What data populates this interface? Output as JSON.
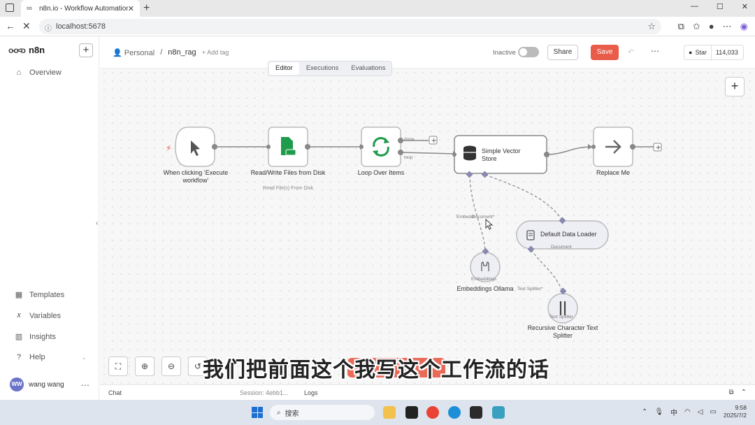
{
  "browser": {
    "tab_title": "n8n.io - Workflow Automation",
    "url": "localhost:5678"
  },
  "sidebar": {
    "brand": "n8n",
    "items": [
      {
        "label": "Overview",
        "icon": "home-icon"
      },
      {
        "label": "Templates",
        "icon": "templates-icon"
      },
      {
        "label": "Variables",
        "icon": "variables-icon"
      },
      {
        "label": "Insights",
        "icon": "insights-icon"
      },
      {
        "label": "Help",
        "icon": "help-icon"
      }
    ],
    "user": {
      "initials": "WW",
      "name": "wang wang"
    }
  },
  "header": {
    "project": "Personal",
    "workflow_name": "n8n_rag",
    "add_tag": "+ Add tag",
    "status": "Inactive",
    "share": "Share",
    "save": "Save",
    "github_star": "Star",
    "github_count": "114,033"
  },
  "view_tabs": [
    "Editor",
    "Executions",
    "Evaluations"
  ],
  "nodes": {
    "trigger": {
      "label": "When clicking ‘Execute workflow’"
    },
    "readwrite": {
      "label": "Read/Write Files from Disk",
      "sub": "Read File(s) From Disk"
    },
    "loop": {
      "label": "Loop Over Items",
      "port_done": "done",
      "port_loop": "loop"
    },
    "vector": {
      "label": "Simple Vector Store",
      "port_embed": "Embeddi",
      "port_doc": "Document*"
    },
    "replace": {
      "label": "Replace Me"
    },
    "loader": {
      "label": "Default Data Loader",
      "port_in": "Document",
      "port_out": "Text Splitter*"
    },
    "embeddings": {
      "label": "Embeddings Ollama",
      "port_in": "Embeddings"
    },
    "splitter": {
      "label": "Recursive Character Text Splitter",
      "port_in": "Text Splitter"
    }
  },
  "bottom": {
    "chat": "Chat",
    "session": "Session: 4ebb1...",
    "logs": "Logs"
  },
  "subtitle": "我们把前面这个我写这个工作流的话",
  "taskbar": {
    "search": "搜索",
    "lang": "中",
    "time": "9:58",
    "date": "2025/7/2"
  },
  "colors": {
    "save": "#ea5c4a",
    "accent_green": "#1e9b4b",
    "node_border": "#bbbbbb"
  }
}
